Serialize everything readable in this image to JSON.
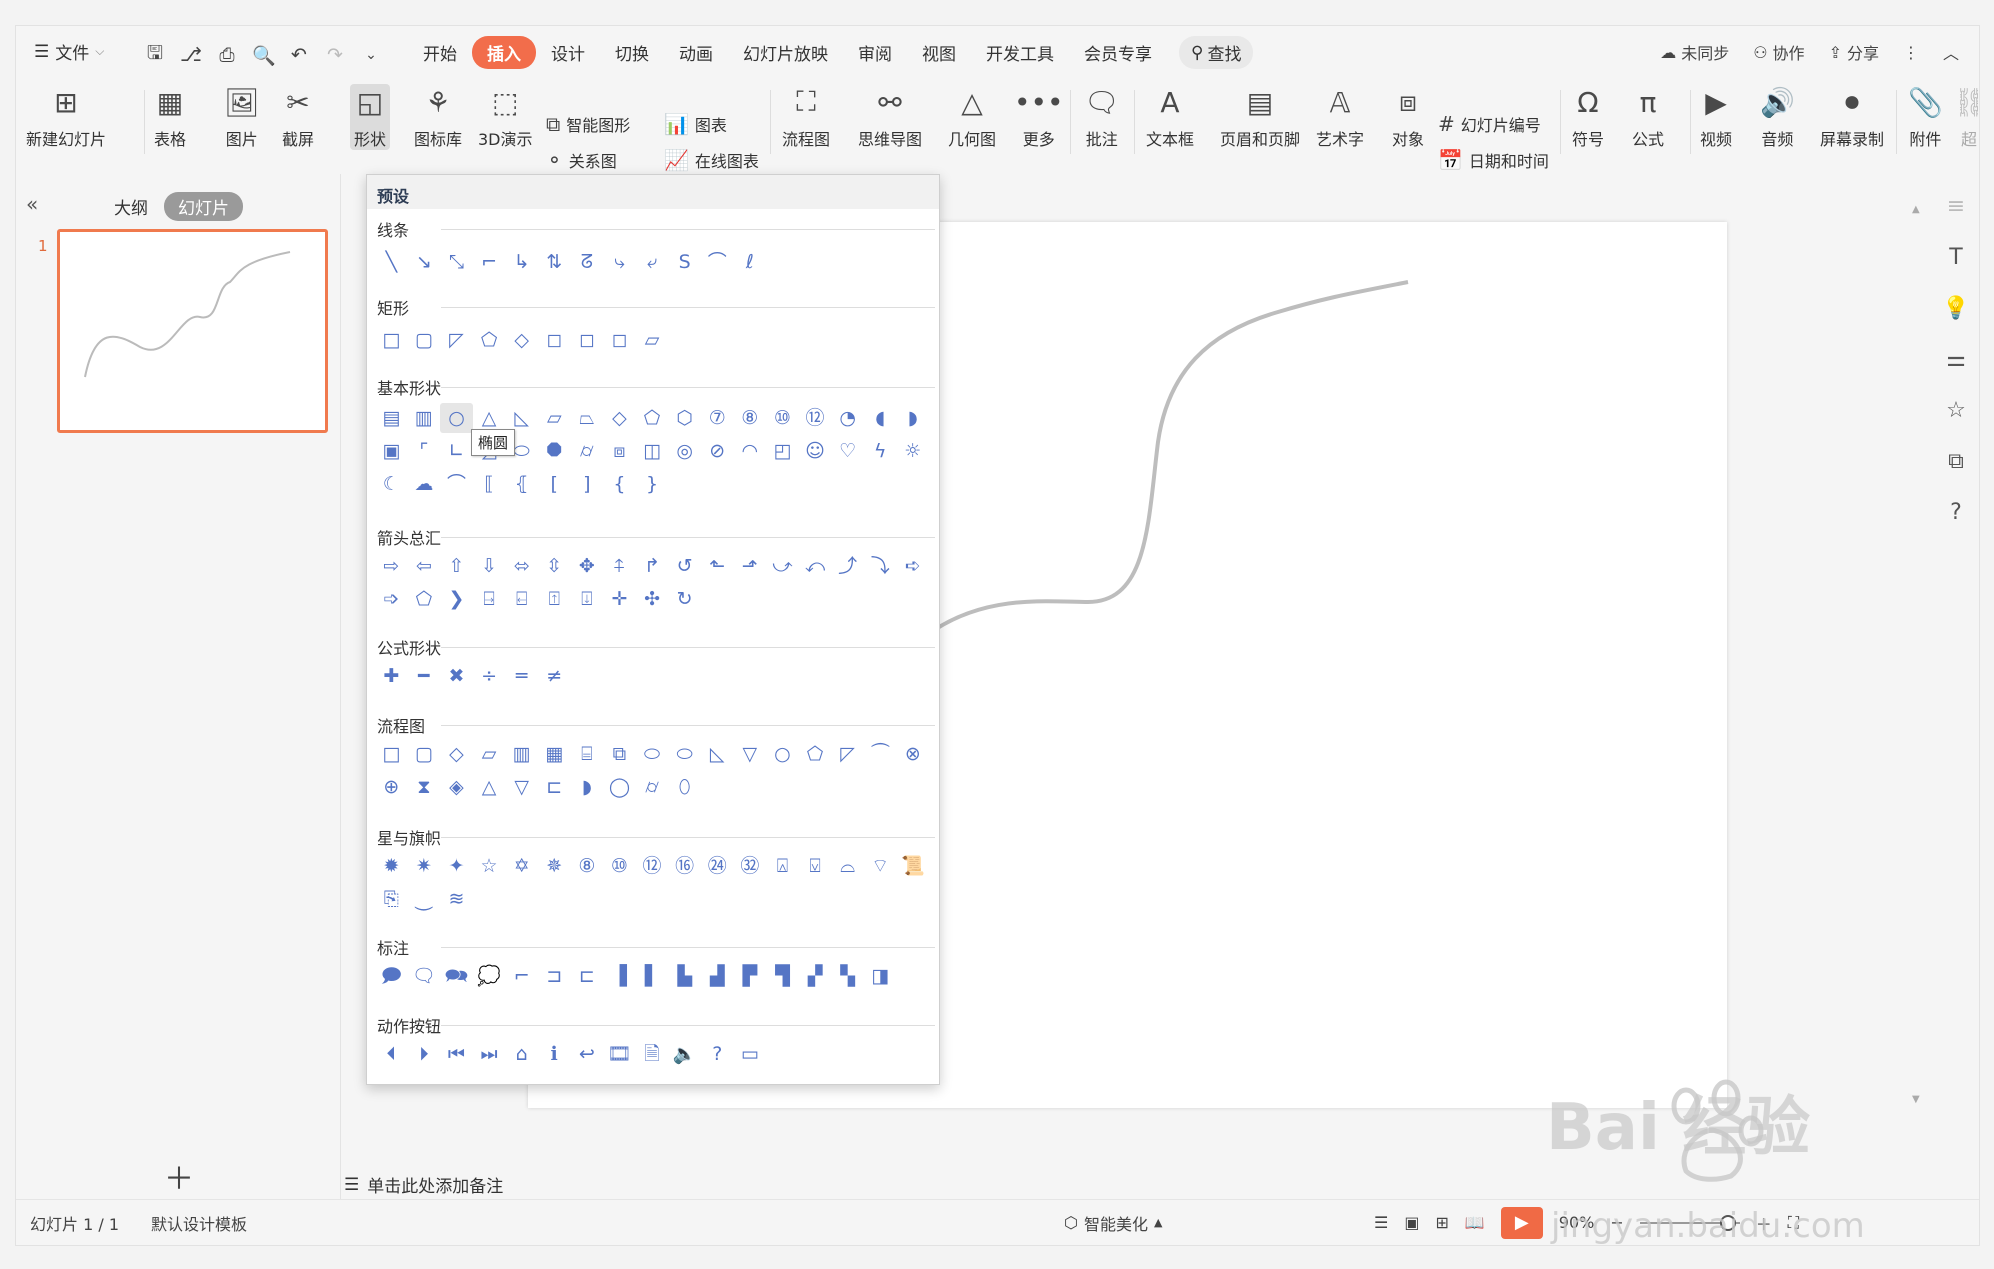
{
  "menubar": {
    "file": "文件",
    "tabs": [
      "开始",
      "插入",
      "设计",
      "切换",
      "动画",
      "幻灯片放映",
      "审阅",
      "视图",
      "开发工具",
      "会员专享"
    ],
    "active_tab": "插入",
    "search": "查找",
    "right": [
      "未同步",
      "协作",
      "分享"
    ]
  },
  "ribbon": {
    "new_slide": "新建幻灯片",
    "table": "表格",
    "picture": "图片",
    "screenshot": "截屏",
    "shape": "形状",
    "icon_lib": "图标库",
    "three_d": "3D演示",
    "smart_art": "智能图形",
    "chart": "图表",
    "relation": "关系图",
    "online_chart": "在线图表",
    "flowchart": "流程图",
    "mindmap": "思维导图",
    "geometry": "几何图",
    "more": "更多",
    "comment": "批注",
    "textbox": "文本框",
    "header_footer": "页眉和页脚",
    "wordart": "艺术字",
    "object": "对象",
    "slide_number": "幻灯片编号",
    "date_time": "日期和时间",
    "symbol": "符号",
    "formula": "公式",
    "video": "视频",
    "audio": "音频",
    "screen_record": "屏幕录制",
    "attachment": "附件",
    "hyperlink_partial": "超"
  },
  "left_panel": {
    "tabs": [
      "大纲",
      "幻灯片"
    ],
    "active": "幻灯片",
    "slide_number": "1"
  },
  "dropdown": {
    "title": "预设",
    "sections": [
      "线条",
      "矩形",
      "基本形状",
      "箭头总汇",
      "公式形状",
      "流程图",
      "星与旗帜",
      "标注",
      "动作按钮"
    ],
    "tooltip": "椭圆"
  },
  "notes": {
    "placeholder": "单击此处添加备注"
  },
  "status": {
    "slide_info": "幻灯片 1 / 1",
    "template": "默认设计模板",
    "beautify": "智能美化",
    "zoom": "90%"
  },
  "watermark": {
    "brand": "Bai 经验",
    "url": "jingyan.baidu.com"
  }
}
